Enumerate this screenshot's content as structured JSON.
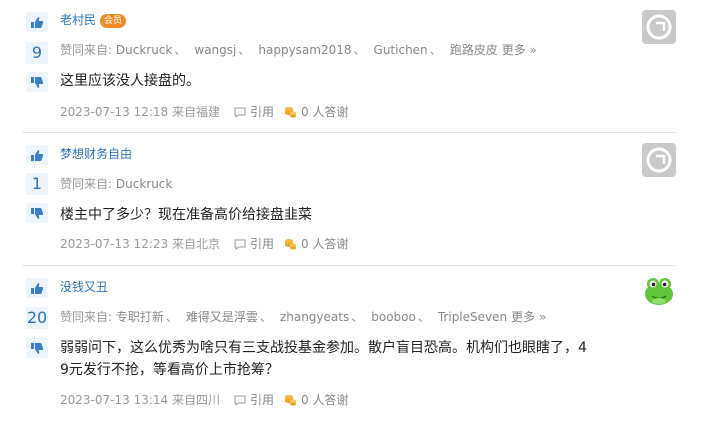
{
  "labels": {
    "support_prefix": "赞同来自:",
    "more": "更多 »",
    "reply": "引用",
    "thanks": "0 人答谢"
  },
  "posts": [
    {
      "author": "老村民",
      "badge": "会员",
      "votes": "9",
      "supporters": [
        "Duckruck",
        "wangsj",
        "happysam2018",
        "Gutichen",
        "跑路皮皮"
      ],
      "has_more": true,
      "content": "这里应该没人接盘的。",
      "meta": "2023-07-13 12:18 来自福建",
      "avatar": "default-avatar"
    },
    {
      "author": "梦想财务自由",
      "badge": "",
      "votes": "1",
      "supporters": [
        "Duckruck"
      ],
      "has_more": false,
      "content": "楼主中了多少？现在准备高价给接盘韭菜",
      "meta": "2023-07-13 12:23 来自北京",
      "avatar": "default-avatar"
    },
    {
      "author": "没钱又丑",
      "badge": "",
      "votes": "20",
      "supporters": [
        "专职打新",
        "难得又是浮雲",
        "zhangyeats",
        "booboo",
        "TripleSeven"
      ],
      "has_more": true,
      "content_line1": "弱弱问下，这么优秀为啥只有三支战投基金参加。散户盲目恐高。机构们也眼瞎了，4",
      "content_line2": "9元发行不抢，等看高价上市抢筹？",
      "meta": "2023-07-13 13:14 来自四川",
      "avatar": "frog-avatar"
    }
  ],
  "colors": {
    "link_blue": "#2d73b9",
    "vote_bg": "#eef4fb",
    "badge_orange": "#f08a24",
    "meta_gray": "#999999",
    "frog_green": "#5fc43a"
  }
}
